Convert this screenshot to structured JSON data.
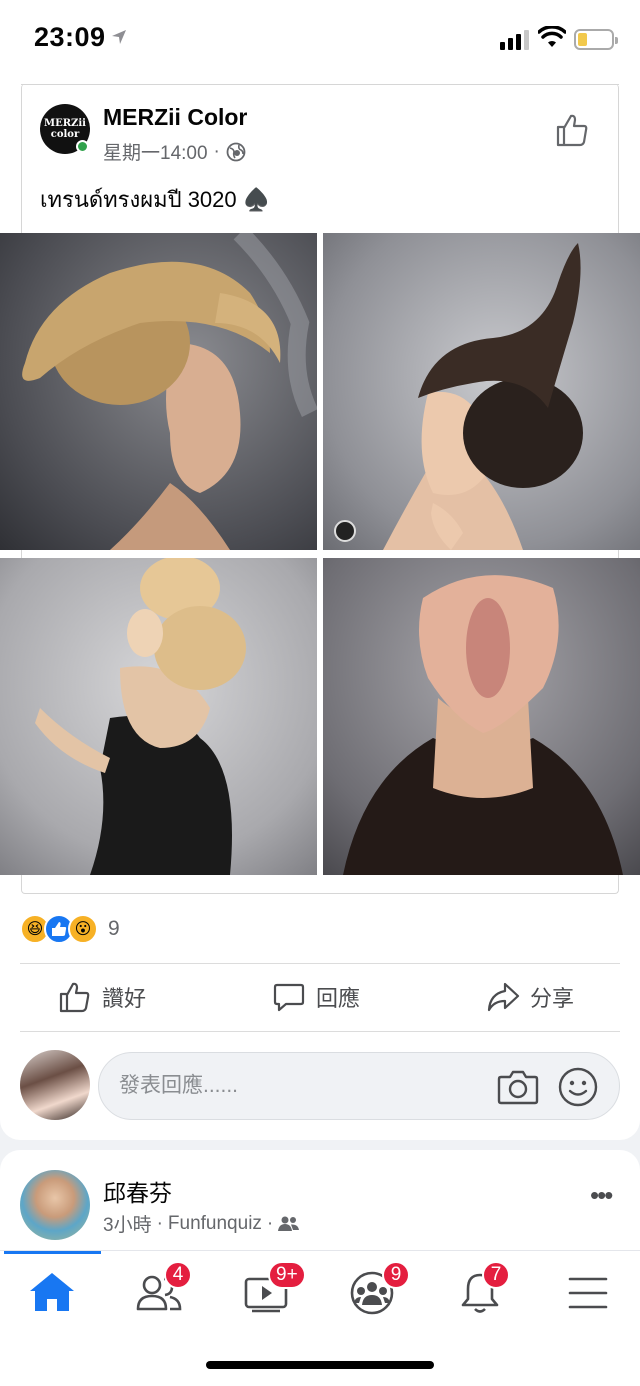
{
  "status_bar": {
    "time": "23:09"
  },
  "post": {
    "page_name": "MERZii Color",
    "page_avatar_text": [
      "MERZii",
      "color"
    ],
    "timestamp": "星期一14:00",
    "meta_separator": "·",
    "text": "เทรนด์ทรงผมปี 3020 ♠️",
    "reactions": {
      "types": [
        "haha",
        "like",
        "wow"
      ],
      "count": "9"
    },
    "actions": {
      "like_label": "讚好",
      "comment_label": "回應",
      "share_label": "分享"
    },
    "comment_placeholder": "發表回應......"
  },
  "next_post": {
    "author": "邱春芬",
    "time_ago": "3小時",
    "separator": "·",
    "source": "Funfunquiz",
    "separator2": "·"
  },
  "tab_bar": {
    "tabs": [
      {
        "name": "home",
        "icon": "home-icon",
        "badge": ""
      },
      {
        "name": "friends",
        "icon": "friends-icon",
        "badge": "4"
      },
      {
        "name": "watch",
        "icon": "watch-icon",
        "badge": "9+"
      },
      {
        "name": "groups",
        "icon": "groups-icon",
        "badge": "9"
      },
      {
        "name": "notifications",
        "icon": "bell-icon",
        "badge": "7"
      },
      {
        "name": "menu",
        "icon": "menu-icon",
        "badge": ""
      }
    ]
  },
  "colors": {
    "accent": "#1877f2",
    "badge": "#e41e3f",
    "online": "#31a24c",
    "secondary_text": "#65676b"
  }
}
